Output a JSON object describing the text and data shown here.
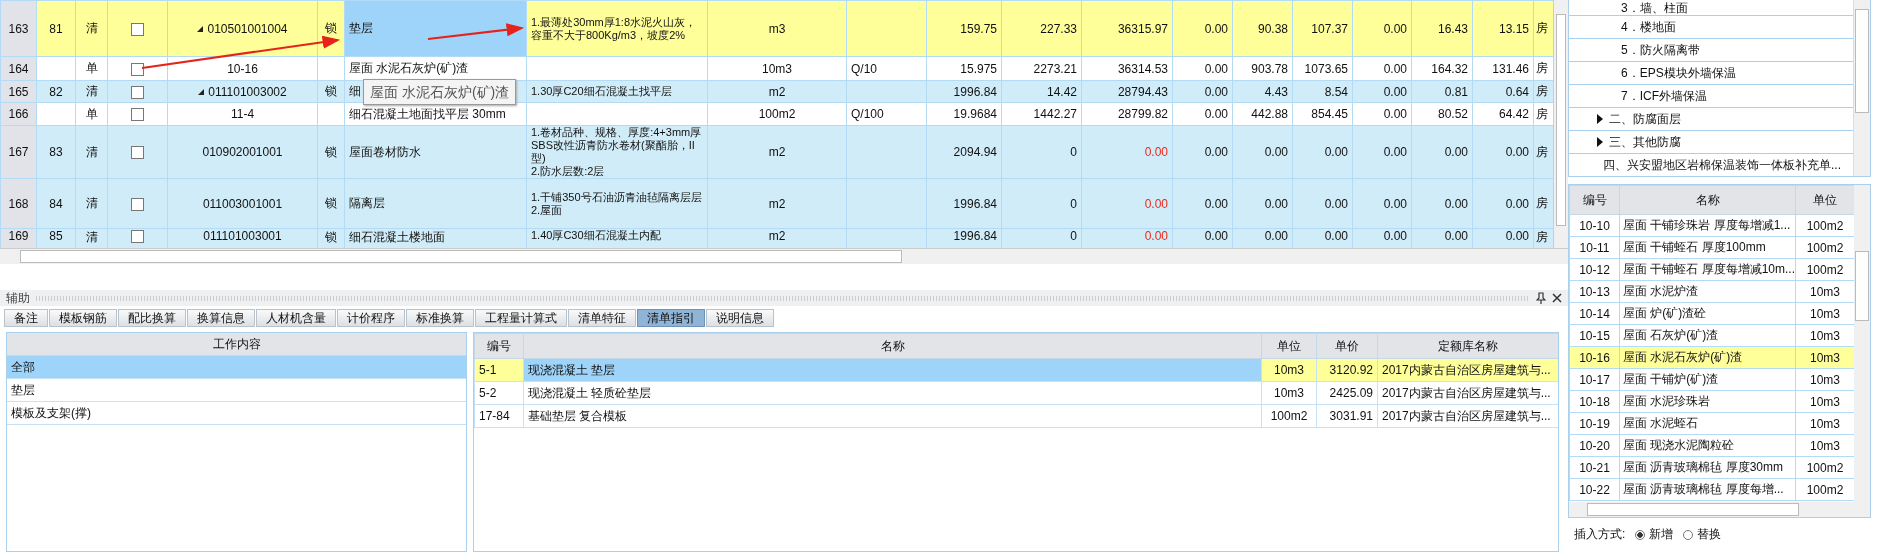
{
  "grid": {
    "rows": [
      {
        "row_no": "163",
        "seq": "81",
        "type": "清",
        "kind": "bill",
        "selected": true,
        "checked": false,
        "has_children": true,
        "code": "010501001004",
        "lock": "锁",
        "name": "垫层",
        "name_active": true,
        "feature": "1.最薄处30mm厚1:8水泥火山灰，容重不大于800Kg/m3，坡度2%",
        "unit": "m3",
        "formula": "",
        "quantity": "159.75",
        "unit_price": "227.33",
        "total": "36315.97",
        "total_alert": false,
        "amounts": [
          "0.00",
          "90.38",
          "107.37",
          "0.00",
          "16.43",
          "13.15"
        ],
        "column_20": "房"
      },
      {
        "row_no": "164",
        "seq": "",
        "type": "单",
        "kind": "quota",
        "selected": false,
        "checked": false,
        "has_children": false,
        "code": "10-16",
        "lock": "",
        "name": "屋面 水泥石灰炉(矿)渣",
        "name_active": false,
        "feature": "",
        "unit": "10m3",
        "formula": "Q/10",
        "quantity": "15.975",
        "unit_price": "2273.21",
        "total": "36314.53",
        "total_alert": false,
        "amounts": [
          "0.00",
          "903.78",
          "1073.65",
          "0.00",
          "164.32",
          "131.46"
        ],
        "column_20": "房"
      },
      {
        "row_no": "165",
        "seq": "82",
        "type": "清",
        "kind": "bill",
        "selected": false,
        "checked": false,
        "has_children": true,
        "code": "011101003002",
        "lock": "锁",
        "name": "细",
        "name_active": false,
        "feature": "1.30厚C20细石混凝土找平层",
        "unit": "m2",
        "formula": "",
        "quantity": "1996.84",
        "unit_price": "14.42",
        "total": "28794.43",
        "total_alert": false,
        "amounts": [
          "0.00",
          "4.43",
          "8.54",
          "0.00",
          "0.81",
          "0.64"
        ],
        "column_20": "房"
      },
      {
        "row_no": "166",
        "seq": "",
        "type": "单",
        "kind": "quota",
        "selected": false,
        "checked": false,
        "has_children": false,
        "code": "11-4",
        "lock": "",
        "name": "细石混凝土地面找平层 30mm",
        "name_active": false,
        "feature": "",
        "unit": "100m2",
        "formula": "Q/100",
        "quantity": "19.9684",
        "unit_price": "1442.27",
        "total": "28799.82",
        "total_alert": false,
        "amounts": [
          "0.00",
          "442.88",
          "854.45",
          "0.00",
          "80.52",
          "64.42"
        ],
        "column_20": "房"
      },
      {
        "row_no": "167",
        "seq": "83",
        "type": "清",
        "kind": "bill",
        "selected": false,
        "checked": false,
        "has_children": false,
        "code": "010902001001",
        "lock": "锁",
        "name": "屋面卷材防水",
        "name_active": false,
        "feature": "1.卷材品种、规格、厚度:4+3mm厚SBS改性沥青防水卷材(聚酯胎，II型)\n2.防水层数:2层",
        "unit": "m2",
        "formula": "",
        "quantity": "2094.94",
        "unit_price": "0",
        "total": "0.00",
        "total_alert": true,
        "amounts": [
          "0.00",
          "0.00",
          "0.00",
          "0.00",
          "0.00",
          "0.00"
        ],
        "column_20": "房"
      },
      {
        "row_no": "168",
        "seq": "84",
        "type": "清",
        "kind": "bill",
        "selected": false,
        "checked": false,
        "has_children": false,
        "code": "011003001001",
        "lock": "锁",
        "name": "隔离层",
        "name_active": false,
        "feature": "1.干铺350号石油沥青油毡隔离层层\n2.屋面",
        "unit": "m2",
        "formula": "",
        "quantity": "1996.84",
        "unit_price": "0",
        "total": "0.00",
        "total_alert": true,
        "amounts": [
          "0.00",
          "0.00",
          "0.00",
          "0.00",
          "0.00",
          "0.00"
        ],
        "column_20": "房"
      },
      {
        "row_no": "169",
        "seq": "85",
        "type": "清",
        "kind": "bill",
        "selected": false,
        "checked": false,
        "has_children": false,
        "code": "011101003001",
        "lock": "锁",
        "name": "细石混凝土楼地面",
        "name_active": false,
        "feature": "1.40厚C30细石混凝土内配",
        "unit": "m2",
        "formula": "",
        "quantity": "1996.84",
        "unit_price": "0",
        "total": "0.00",
        "total_alert": true,
        "amounts": [
          "0.00",
          "0.00",
          "0.00",
          "0.00",
          "0.00",
          "0.00"
        ],
        "column_20": "房"
      }
    ]
  },
  "tooltip": {
    "text": "屋面 水泥石灰炉(矿)渣"
  },
  "aux_panel": {
    "title": "辅助"
  },
  "tabs": [
    {
      "label": "备注",
      "selected": false
    },
    {
      "label": "模板钢筋",
      "selected": false
    },
    {
      "label": "配比换算",
      "selected": false
    },
    {
      "label": "换算信息",
      "selected": false
    },
    {
      "label": "人材机含量",
      "selected": false
    },
    {
      "label": "计价程序",
      "selected": false
    },
    {
      "label": "标准换算",
      "selected": false
    },
    {
      "label": "工程量计算式",
      "selected": false
    },
    {
      "label": "清单特征",
      "selected": false
    },
    {
      "label": "清单指引",
      "selected": true
    },
    {
      "label": "说明信息",
      "selected": false
    }
  ],
  "work_content": {
    "header": "工作内容",
    "items": [
      {
        "label": "全部",
        "selected": true
      },
      {
        "label": "垫层",
        "selected": false
      },
      {
        "label": "模板及支架(撑)",
        "selected": false
      }
    ]
  },
  "guide_table": {
    "columns": [
      "编号",
      "名称",
      "单位",
      "单价",
      "定额库名称"
    ],
    "rows": [
      {
        "code": "5-1",
        "name": "现浇混凝土 垫层",
        "unit": "10m3",
        "price": "3120.92",
        "library": "2017内蒙古自治区房屋建筑与...",
        "selected": true
      },
      {
        "code": "5-2",
        "name": "现浇混凝土 轻质砼垫层",
        "unit": "10m3",
        "price": "2425.09",
        "library": "2017内蒙古自治区房屋建筑与...",
        "selected": false
      },
      {
        "code": "17-84",
        "name": "基础垫层 复合模板",
        "unit": "100m2",
        "price": "3031.91",
        "library": "2017内蒙古自治区房屋建筑与...",
        "selected": false
      }
    ]
  },
  "tree": {
    "open_group_children": [
      "3．墙、柱面",
      "4．楼地面",
      "5．防火隔离带",
      "6．EPS模块外墙保温",
      "7．ICF外墙保温"
    ],
    "groups": [
      {
        "label": "二、防腐面层",
        "has_children": true
      },
      {
        "label": "三、其他防腐",
        "has_children": true
      },
      {
        "label": "四、兴安盟地区岩棉保温装饰一体板补充单...",
        "has_children": false
      }
    ]
  },
  "quota_list": {
    "columns": [
      "编号",
      "名称",
      "单位"
    ],
    "rows": [
      {
        "code": "10-10",
        "name": "屋面 干铺珍珠岩 厚度每增减1...",
        "unit": "100m2",
        "selected": false
      },
      {
        "code": "10-11",
        "name": "屋面 干铺蛭石 厚度100mm",
        "unit": "100m2",
        "selected": false
      },
      {
        "code": "10-12",
        "name": "屋面 干铺蛭石 厚度每增减10m...",
        "unit": "100m2",
        "selected": false
      },
      {
        "code": "10-13",
        "name": "屋面 水泥炉渣",
        "unit": "10m3",
        "selected": false
      },
      {
        "code": "10-14",
        "name": "屋面 炉(矿)渣砼",
        "unit": "10m3",
        "selected": false
      },
      {
        "code": "10-15",
        "name": "屋面 石灰炉(矿)渣",
        "unit": "10m3",
        "selected": false
      },
      {
        "code": "10-16",
        "name": "屋面 水泥石灰炉(矿)渣",
        "unit": "10m3",
        "selected": true
      },
      {
        "code": "10-17",
        "name": "屋面 干铺炉(矿)渣",
        "unit": "10m3",
        "selected": false
      },
      {
        "code": "10-18",
        "name": "屋面 水泥珍珠岩",
        "unit": "10m3",
        "selected": false
      },
      {
        "code": "10-19",
        "name": "屋面 水泥蛭石",
        "unit": "10m3",
        "selected": false
      },
      {
        "code": "10-20",
        "name": "屋面 现浇水泥陶粒砼",
        "unit": "10m3",
        "selected": false
      },
      {
        "code": "10-21",
        "name": "屋面 沥青玻璃棉毡 厚度30mm",
        "unit": "100m2",
        "selected": false
      },
      {
        "code": "10-22",
        "name": "屋面 沥青玻璃棉毡 厚度每增...",
        "unit": "100m2",
        "selected": false
      }
    ]
  },
  "insert_mode": {
    "label": "插入方式:",
    "options": [
      {
        "label": "新增",
        "selected": true
      },
      {
        "label": "替换",
        "selected": false
      }
    ]
  }
}
